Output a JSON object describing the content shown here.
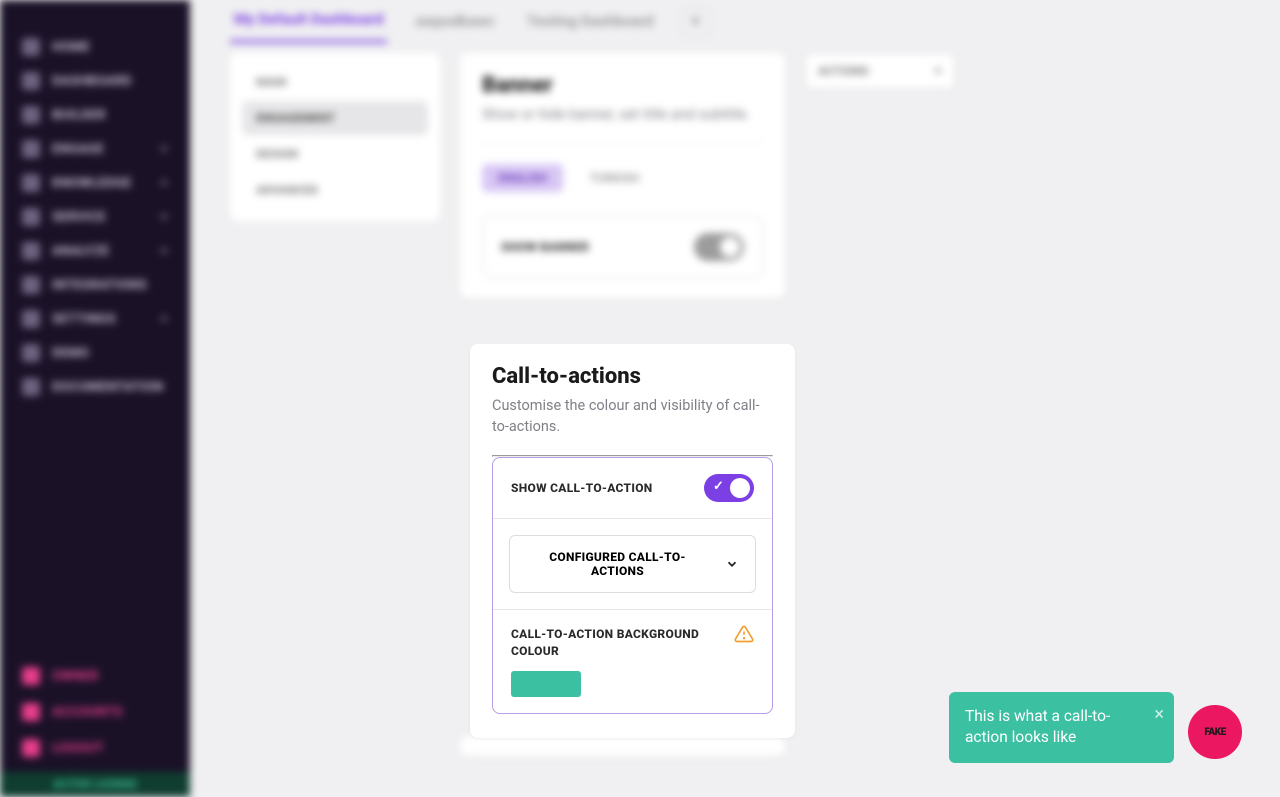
{
  "sidebar": {
    "items": [
      {
        "label": "HOME",
        "expandable": false
      },
      {
        "label": "DASHBOARD",
        "expandable": false
      },
      {
        "label": "BUILDER",
        "expandable": false
      },
      {
        "label": "ENGAGE",
        "expandable": true
      },
      {
        "label": "KNOWLEDGE",
        "expandable": true
      },
      {
        "label": "SERVICE",
        "expandable": true
      },
      {
        "label": "ANALYZE",
        "expandable": true
      },
      {
        "label": "INTEGRATIONS",
        "expandable": false
      },
      {
        "label": "SETTINGS",
        "expandable": true
      },
      {
        "label": "DEMO",
        "expandable": false
      },
      {
        "label": "DOCUMENTATION",
        "expandable": false
      }
    ],
    "bottom": [
      {
        "label": "OWNER"
      },
      {
        "label": "ACCOUNTS"
      },
      {
        "label": "LOGOUT"
      }
    ],
    "license": "ACTIVE LICENSE"
  },
  "tabs": [
    {
      "label": "My Default Dashboard",
      "active": true
    },
    {
      "label": "awpodkawc",
      "active": false
    },
    {
      "label": "Testing Dashboard",
      "active": false
    }
  ],
  "settings_menu": [
    "MAIN",
    "ENGAGEMENT",
    "DESIGN",
    "ADVANCED"
  ],
  "actions_label": "ACTIONS",
  "banner_card": {
    "title": "Banner",
    "subtitle": "Show or hide banner, set title and subtitle.",
    "lang_active": "ENGLISH",
    "lang_inactive": "TURKISH",
    "toggle_label": "SHOW BANNER"
  },
  "cta_card": {
    "title": "Call-to-actions",
    "subtitle": "Customise the colour and visibility of call-to-actions.",
    "toggle_label": "SHOW CALL-TO-ACTION",
    "dropdown_label": "CONFIGURED CALL-TO-ACTIONS",
    "bg_label": "CALL-TO-ACTION BACKGROUND COLOUR",
    "bg_color": "#3bc0a2"
  },
  "popup": "This is what a call-to-action looks like",
  "fab": "FAKE"
}
